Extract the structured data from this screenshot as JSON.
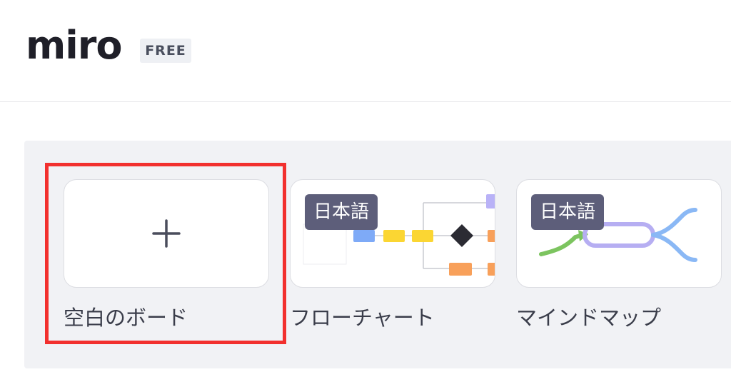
{
  "header": {
    "logo_text": "miro",
    "plan_badge": "FREE"
  },
  "templates": [
    {
      "id": "blank",
      "label": "空白のボード",
      "icon": "plus-icon",
      "badge": ""
    },
    {
      "id": "flowchart",
      "label": "フローチャート",
      "icon": "flowchart-preview",
      "badge": "日本語"
    },
    {
      "id": "mindmap",
      "label": "マインドマップ",
      "icon": "mindmap-preview",
      "badge": "日本語"
    }
  ],
  "colors": {
    "highlight": "#f2302e",
    "panel_bg": "#f1f2f5",
    "badge_bg": "#5d5e7a",
    "flow_blue": "#7eaaf7",
    "flow_yellow": "#fbd633",
    "flow_orange": "#f8a05a",
    "flow_purple": "#b9b2f7",
    "mind_green": "#7cc45f",
    "mind_purple": "#b6aef2",
    "mind_blue": "#8ab8f5"
  }
}
